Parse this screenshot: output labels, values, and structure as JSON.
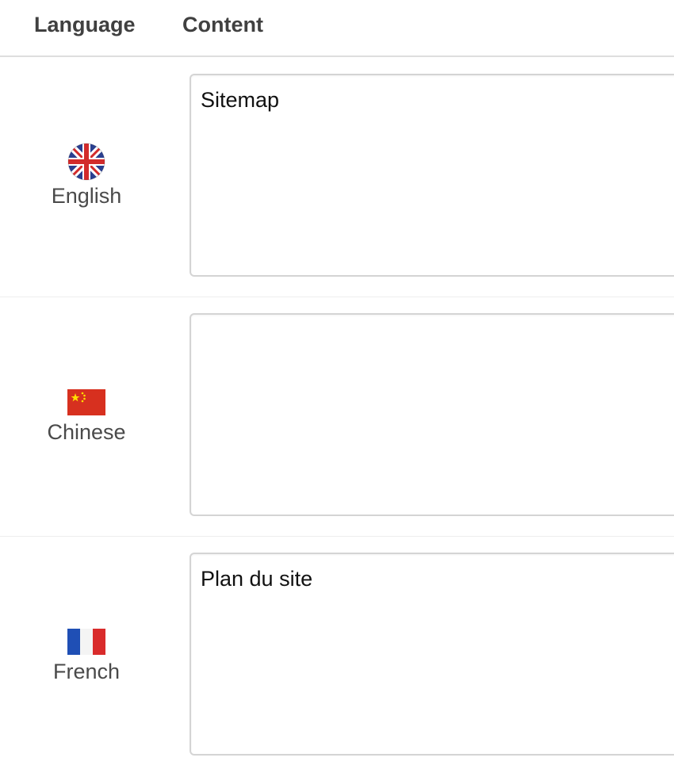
{
  "table": {
    "headers": {
      "language": "Language",
      "content": "Content"
    },
    "rows": [
      {
        "language": "English",
        "flag_icon": "uk-flag-icon",
        "content": "Sitemap",
        "placeholder": ""
      },
      {
        "language": "Chinese",
        "flag_icon": "china-flag-icon",
        "content": "",
        "placeholder": ""
      },
      {
        "language": "French",
        "flag_icon": "france-flag-icon",
        "content": "Plan du site",
        "placeholder": ""
      }
    ]
  },
  "colors": {
    "header_text": "#404040",
    "label_text": "#4a4a4a",
    "border": "#d4d4d4"
  }
}
